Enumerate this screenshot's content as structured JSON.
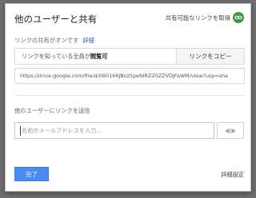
{
  "dialog": {
    "title": "他のユーザーと共有",
    "get_link_label": "共有可能なリンクを取得",
    "get_link_icon": "link-icon"
  },
  "link_sharing": {
    "status": "リンクの共有がオンです",
    "details_label": "詳細",
    "access_prefix": "リンクを知っている全員が",
    "access_level": "閲覧可",
    "copy_button_label": "リンクをコピー",
    "url": "https://drive.google.com/file/d/0B0166JBoz5peNlRZZ0ZZVDJFaWM/view?usp=sha"
  },
  "invite": {
    "section_label": "他のユーザーにリンクを送信",
    "input_placeholder": "名前かメールアドレスを入力...",
    "permission_icon": "eye-icon"
  },
  "footer": {
    "done_label": "完了",
    "advanced_label": "詳細設定"
  },
  "colors": {
    "accent_blue": "#4a8af4",
    "link_icon_green": "#3e9b47",
    "link_text_blue": "#2a5db0"
  }
}
